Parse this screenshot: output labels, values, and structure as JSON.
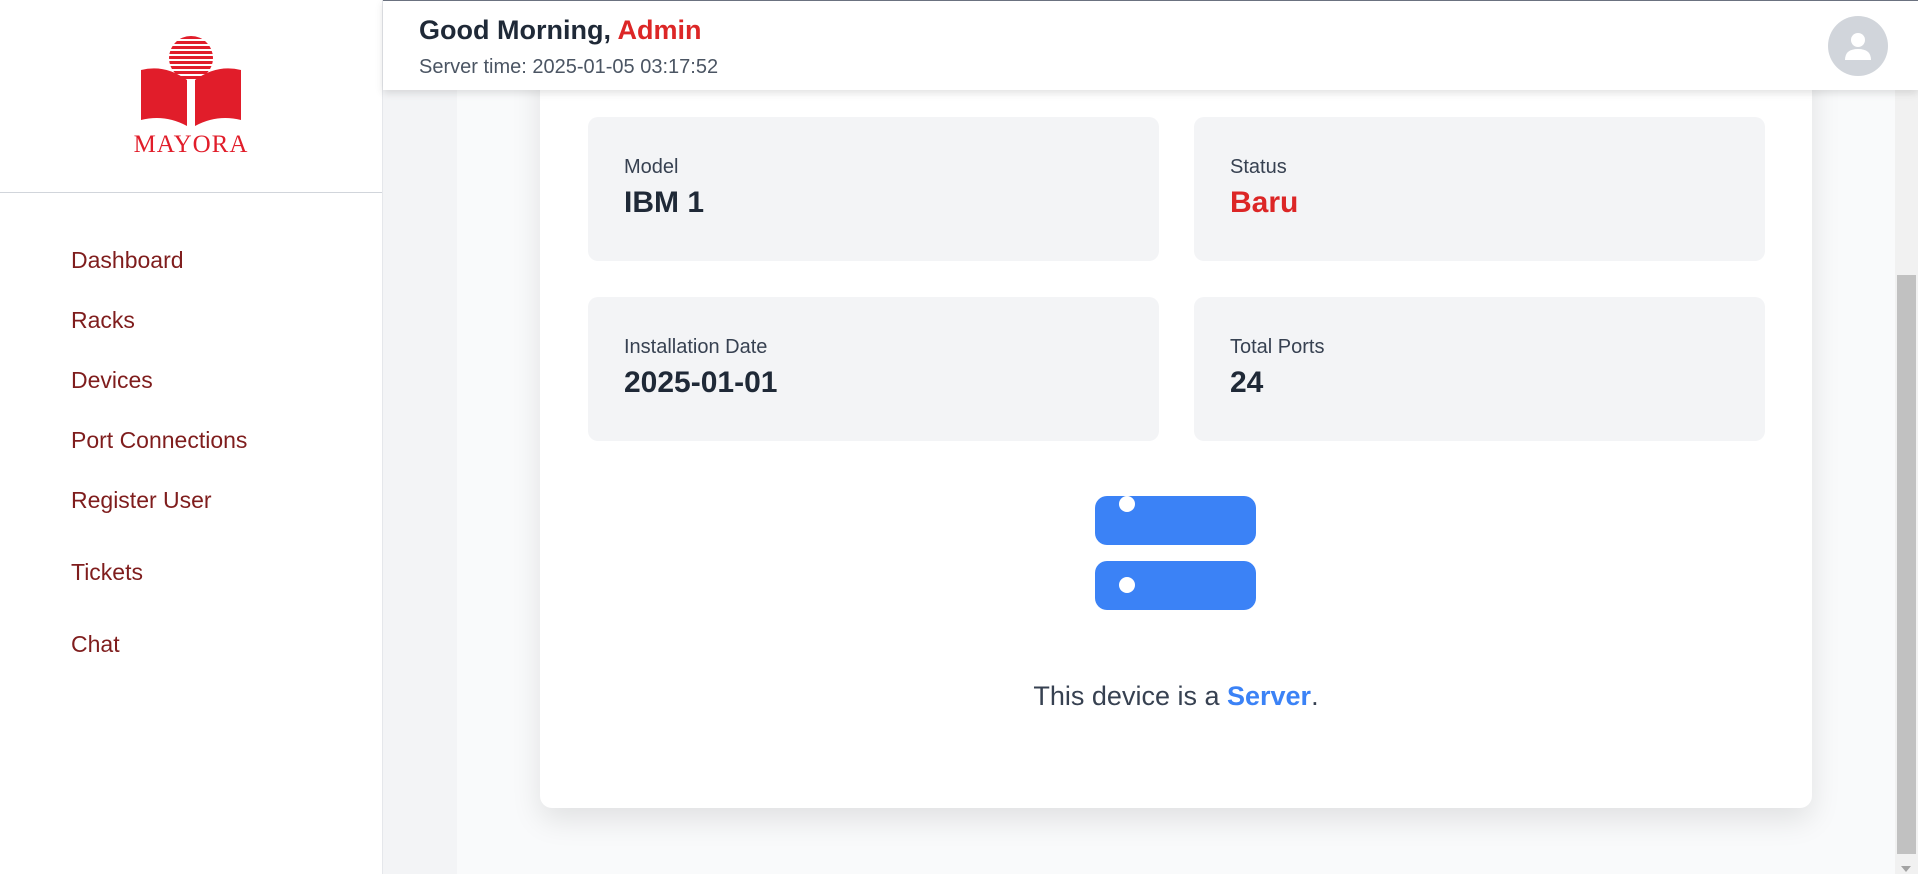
{
  "brand": {
    "name": "MAYORA",
    "color": "#e11d2a"
  },
  "sidebar": {
    "items": [
      {
        "label": "Dashboard"
      },
      {
        "label": "Racks"
      },
      {
        "label": "Devices"
      },
      {
        "label": "Port Connections"
      },
      {
        "label": "Register User"
      },
      {
        "label": "Tickets"
      },
      {
        "label": "Chat"
      }
    ]
  },
  "header": {
    "greeting_prefix": "Good Morning, ",
    "user_name": "Admin",
    "server_time": "Server time: 2025-01-05 03:17:52",
    "avatar_icon": "user-avatar-icon"
  },
  "device": {
    "model_label": "Model",
    "model_value": "IBM 1",
    "status_label": "Status",
    "status_value": "Baru",
    "install_label": "Installation Date",
    "install_value": "2025-01-01",
    "ports_label": "Total Ports",
    "ports_value": "24",
    "icon": "server-icon",
    "description_prefix": "This device is a ",
    "type": "Server",
    "description_suffix": "."
  },
  "colors": {
    "accent_red": "#dc2626",
    "nav_text": "#7f1d1d",
    "server_blue": "#3b82f6"
  }
}
